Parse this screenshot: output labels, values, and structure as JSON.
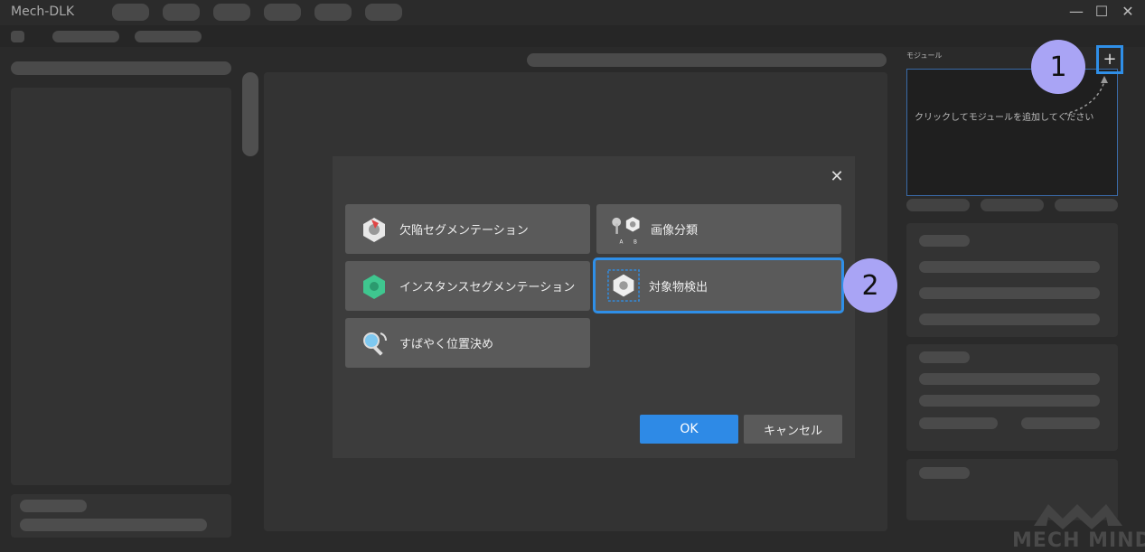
{
  "app": {
    "title": "Mech-DLK"
  },
  "window_controls": {
    "minimize": "—",
    "maximize": "☐",
    "close": "✕"
  },
  "dialog": {
    "close": "✕",
    "options": [
      {
        "label": "欠陥セグメンテーション",
        "icon": "defect-segmentation-icon"
      },
      {
        "label": "画像分類",
        "icon": "image-classification-icon"
      },
      {
        "label": "インスタンスセグメンテーション",
        "icon": "instance-segmentation-icon"
      },
      {
        "label": "対象物検出",
        "icon": "object-detection-icon",
        "selected": true
      },
      {
        "label": "すばやく位置決め",
        "icon": "fast-positioning-icon"
      }
    ],
    "ok_label": "OK",
    "cancel_label": "キャンセル"
  },
  "module_panel": {
    "header": "モジュール",
    "hint": "クリックしてモジュールを追加してください",
    "add_button": "+"
  },
  "annotations": {
    "badge1": "1",
    "badge2": "2"
  },
  "watermark": "MECH MIND",
  "colors": {
    "accent": "#2f8fe8",
    "badge": "#a9a4f5"
  }
}
